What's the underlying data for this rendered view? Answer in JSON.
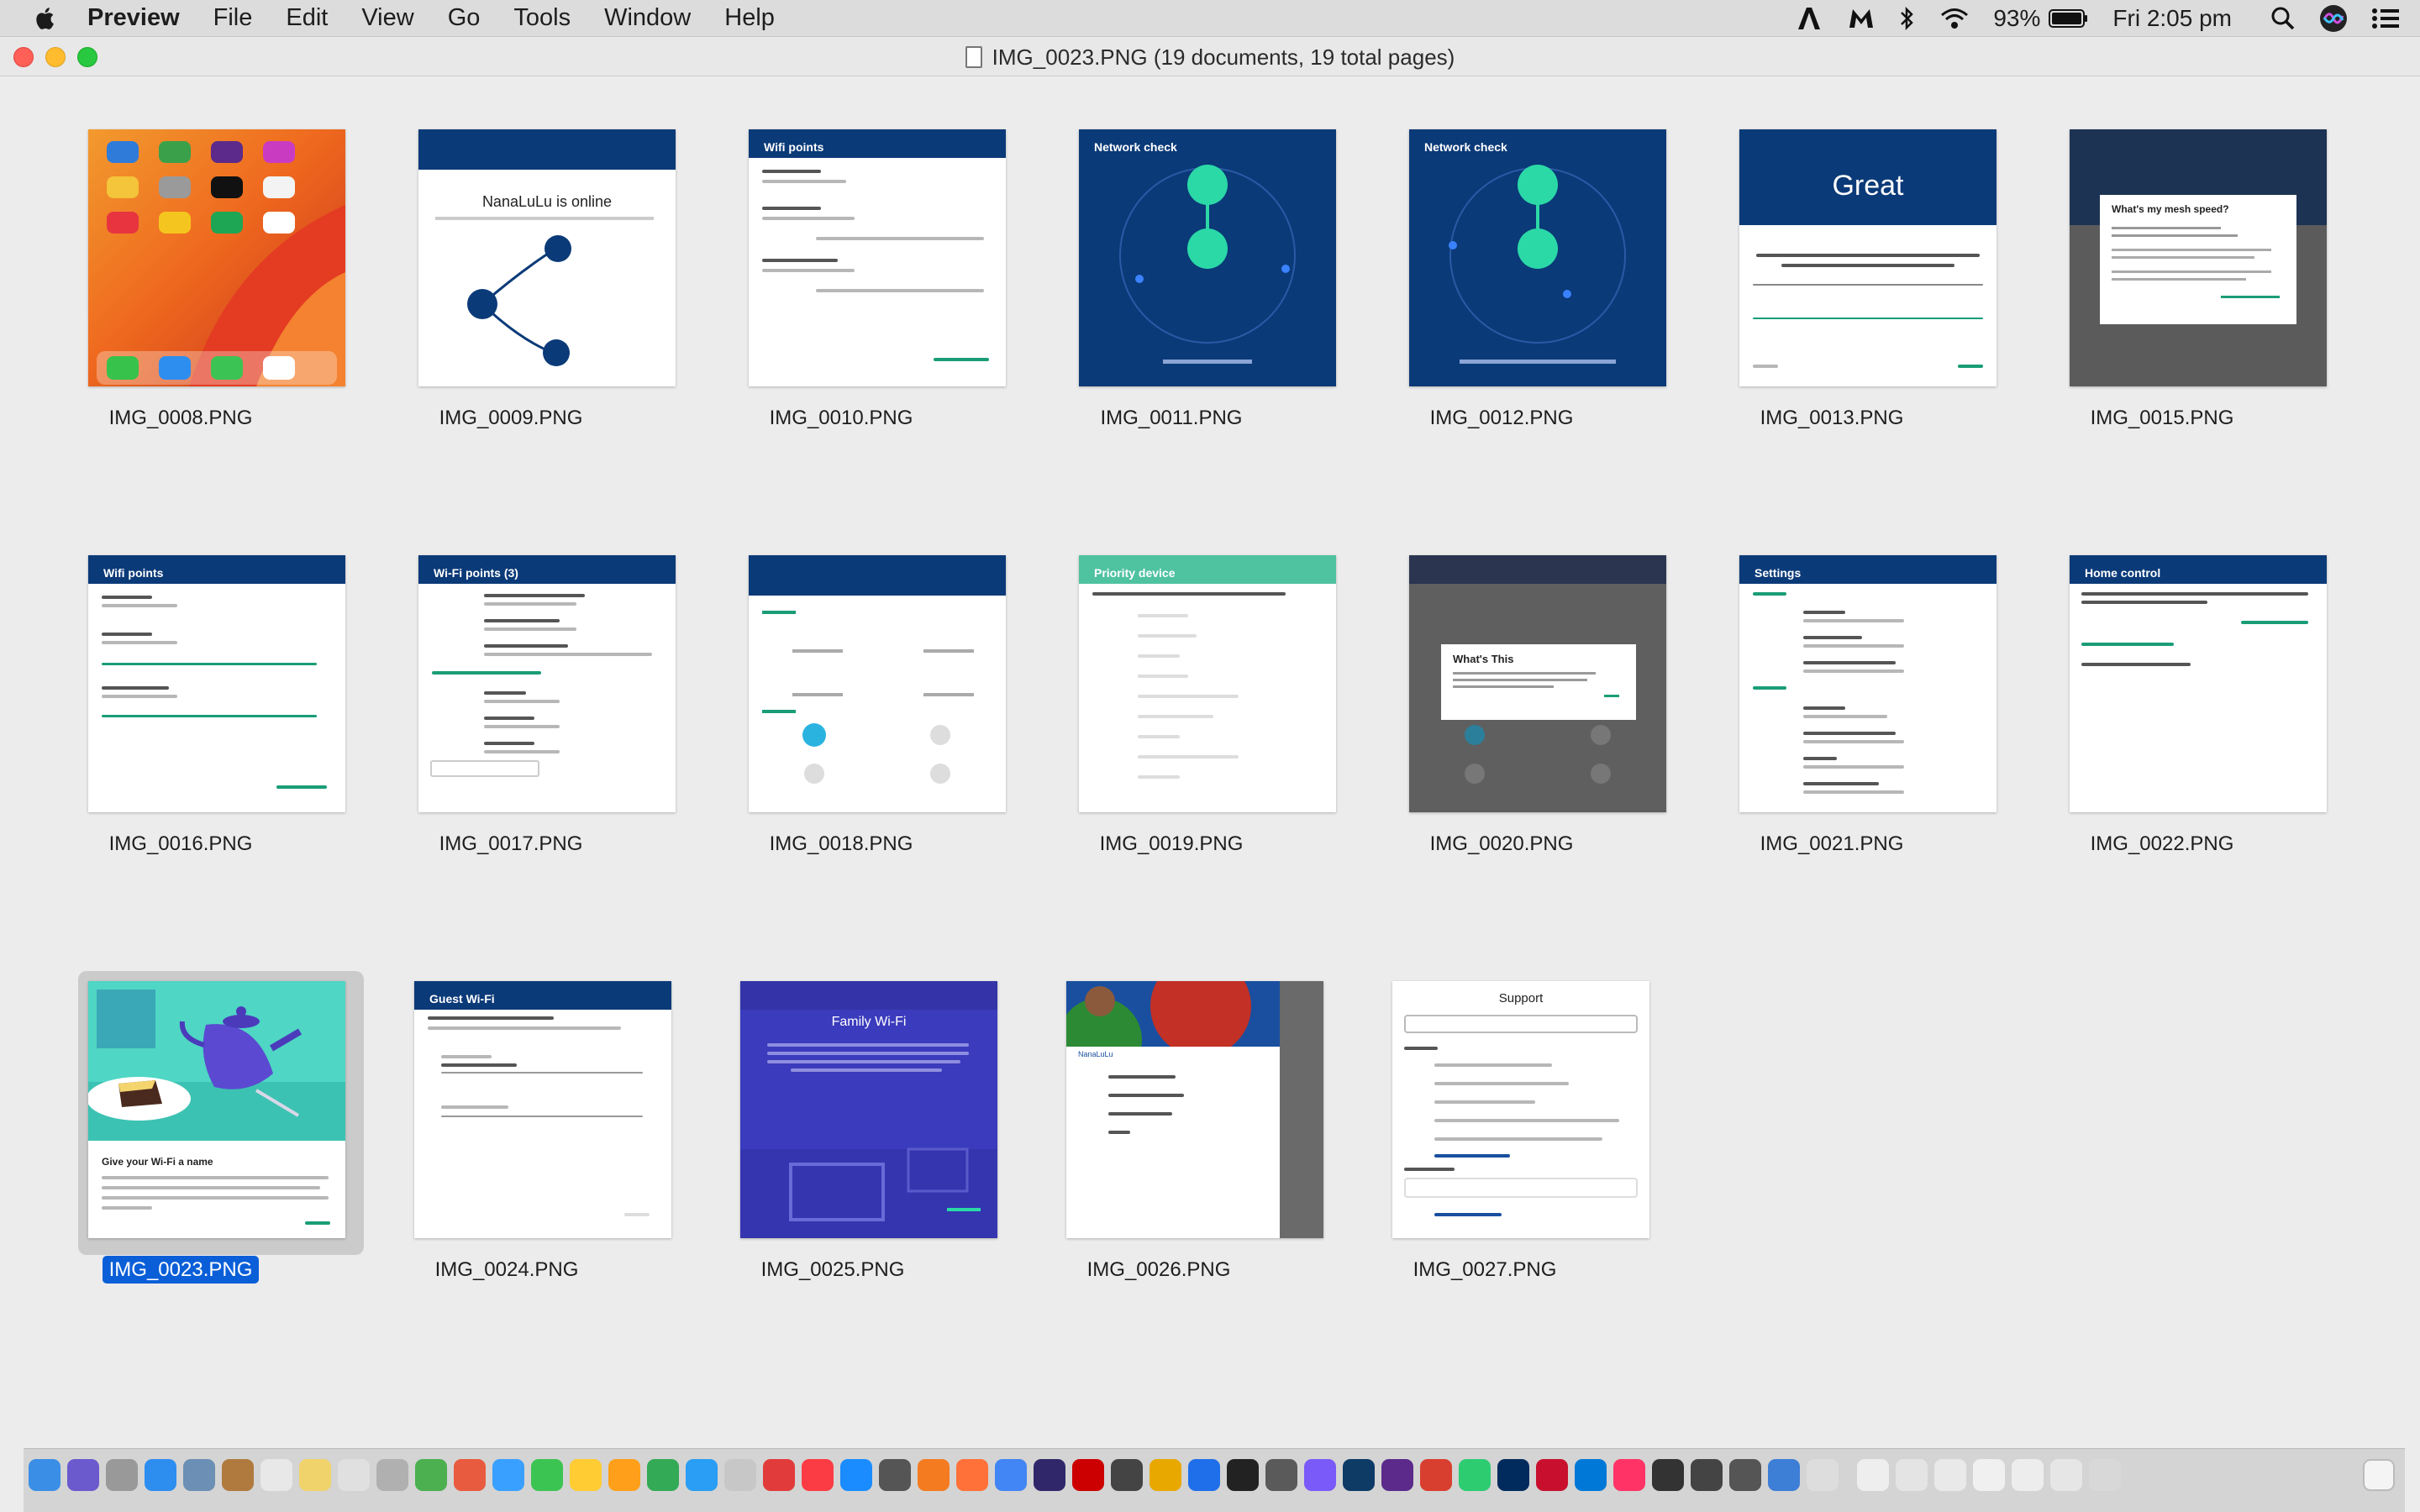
{
  "menubar": {
    "items": [
      "Preview",
      "File",
      "Edit",
      "View",
      "Go",
      "Tools",
      "Window",
      "Help"
    ],
    "battery": "93%",
    "clock": "Fri 2:05 pm"
  },
  "window": {
    "title": "IMG_0023.PNG (19 documents, 19 total pages)"
  },
  "thumbnails": [
    {
      "file": "IMG_0008.PNG",
      "kind": "home",
      "screen_title": ""
    },
    {
      "file": "IMG_0009.PNG",
      "kind": "online",
      "screen_title": "NanaLuLu is online"
    },
    {
      "file": "IMG_0010.PNG",
      "kind": "list",
      "screen_title": "Wifi points"
    },
    {
      "file": "IMG_0011.PNG",
      "kind": "network",
      "screen_title": "Network check"
    },
    {
      "file": "IMG_0012.PNG",
      "kind": "network",
      "screen_title": "Network check"
    },
    {
      "file": "IMG_0013.PNG",
      "kind": "great",
      "screen_title": "Great"
    },
    {
      "file": "IMG_0015.PNG",
      "kind": "dialog",
      "screen_title": "What's my mesh speed?"
    },
    {
      "file": "IMG_0016.PNG",
      "kind": "list",
      "screen_title": "Wifi points"
    },
    {
      "file": "IMG_0017.PNG",
      "kind": "list",
      "screen_title": "Wi-Fi points (3)"
    },
    {
      "file": "IMG_0018.PNG",
      "kind": "grid",
      "screen_title": ""
    },
    {
      "file": "IMG_0019.PNG",
      "kind": "priority",
      "screen_title": "Priority device"
    },
    {
      "file": "IMG_0020.PNG",
      "kind": "dialog",
      "screen_title": "What's This"
    },
    {
      "file": "IMG_0021.PNG",
      "kind": "list",
      "screen_title": "Settings"
    },
    {
      "file": "IMG_0022.PNG",
      "kind": "list",
      "screen_title": "Home control"
    },
    {
      "file": "IMG_0023.PNG",
      "kind": "teapot",
      "screen_title": "Give your Wi-Fi a name",
      "selected": true
    },
    {
      "file": "IMG_0024.PNG",
      "kind": "list",
      "screen_title": "Guest Wi-Fi"
    },
    {
      "file": "IMG_0025.PNG",
      "kind": "family",
      "screen_title": "Family Wi-Fi"
    },
    {
      "file": "IMG_0026.PNG",
      "kind": "drawer",
      "screen_title": "NanaLuLu"
    },
    {
      "file": "IMG_0027.PNG",
      "kind": "support",
      "screen_title": "Support"
    }
  ],
  "colors": {
    "google_blue_dark": "#0b3a78",
    "google_teal": "#2bd9a7",
    "family_purple": "#3b3bbd",
    "priority_green": "#4fc2a0",
    "selection_blue": "#0a5fd8"
  }
}
